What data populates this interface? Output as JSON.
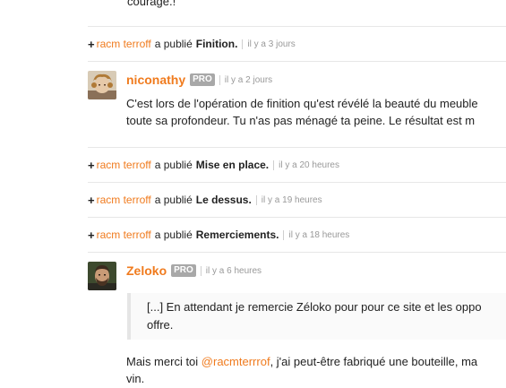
{
  "top_fragment": "courage.!",
  "activities": [
    {
      "user": "racm terroff",
      "verb": "a publié",
      "title": "Finition.",
      "time": "il y a 3 jours"
    },
    {
      "user": "racm terroff",
      "verb": "a publié",
      "title": "Mise en place.",
      "time": "il y a 20 heures"
    },
    {
      "user": "racm terroff",
      "verb": "a publié",
      "title": "Le dessus.",
      "time": "il y a 19 heures"
    },
    {
      "user": "racm terroff",
      "verb": "a publié",
      "title": "Remerciements.",
      "time": "il y a 18 heures"
    }
  ],
  "comments": [
    {
      "author": "niconathy",
      "badge": "PRO",
      "time": "il y a 2 jours",
      "lines": [
        "C'est lors de l'opération de finition qu'est révélé la beauté du meuble",
        "toute sa profondeur. Tu n'as pas ménagé ta peine. Le résultat est m"
      ]
    },
    {
      "author": "Zeloko",
      "badge": "PRO",
      "time": "il y a 6 heures",
      "quote_lines": [
        "[...] En attendant je remercie Zéloko pour pour ce site et les oppo",
        "offre."
      ],
      "text_before_mention": "Mais merci toi ",
      "mention": "@racmterrrof",
      "text_after_mention": ", j'ai peut-être fabriqué une bouteille, ma",
      "text_line2": "vin."
    }
  ],
  "colors": {
    "link": "#f07b1e",
    "badge_bg": "#a8a8a8",
    "divider": "#e7e7e7"
  },
  "icons": {
    "plus": "plus-icon"
  }
}
